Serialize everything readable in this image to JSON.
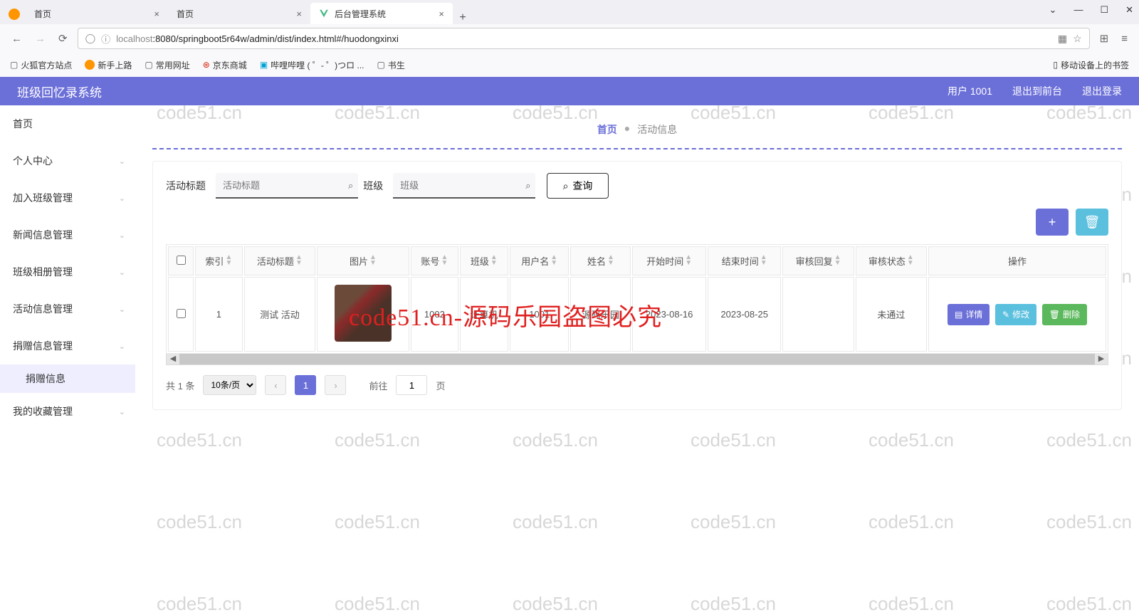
{
  "watermark_text": "code51.cn",
  "browser": {
    "tabs": [
      {
        "title": "首页"
      },
      {
        "title": "首页"
      },
      {
        "title": "后台管理系统",
        "active": true
      }
    ],
    "url_host": "localhost",
    "url_path": ":8080/springboot5r64w/admin/dist/index.html#/huodongxinxi",
    "bookmarks": [
      "火狐官方站点",
      "新手上路",
      "常用网址",
      "京东商城",
      "哔哩哔哩 ( ゜- ゜)つロ ...",
      "书生"
    ],
    "bookmark_right": "移动设备上的书签"
  },
  "app": {
    "title": "班级回忆录系统",
    "user": "用户 1001",
    "exit_front": "退出到前台",
    "logout": "退出登录"
  },
  "sidebar": {
    "items": [
      "首页",
      "个人中心",
      "加入班级管理",
      "新闻信息管理",
      "班级相册管理",
      "活动信息管理",
      "捐赠信息管理"
    ],
    "sub": "捐赠信息",
    "last": "我的收藏管理"
  },
  "crumb": {
    "home": "首页",
    "current": "活动信息"
  },
  "search": {
    "label1": "活动标题",
    "ph1": "活动标题",
    "label2": "班级",
    "ph2": "班级",
    "query": "查询"
  },
  "table": {
    "headers": [
      "索引",
      "活动标题",
      "图片",
      "账号",
      "班级",
      "用户名",
      "姓名",
      "开始时间",
      "结束时间",
      "审核回复",
      "审核状态",
      "操作"
    ],
    "row": {
      "idx": "1",
      "title": "测试 活动",
      "account": "1002",
      "class": "计算机",
      "user": "1001",
      "name": "源码乐园",
      "start": "2023-08-16",
      "end": "2023-08-25",
      "reply": "",
      "status": "未通过"
    },
    "actions": {
      "view": "详情",
      "edit": "修改",
      "del": "删除"
    }
  },
  "pager": {
    "total": "共 1 条",
    "size": "10条/页",
    "page": "1",
    "goto": "前往",
    "unit": "页",
    "input": "1"
  },
  "overlay": "code51.cn-源码乐园盗图必究"
}
